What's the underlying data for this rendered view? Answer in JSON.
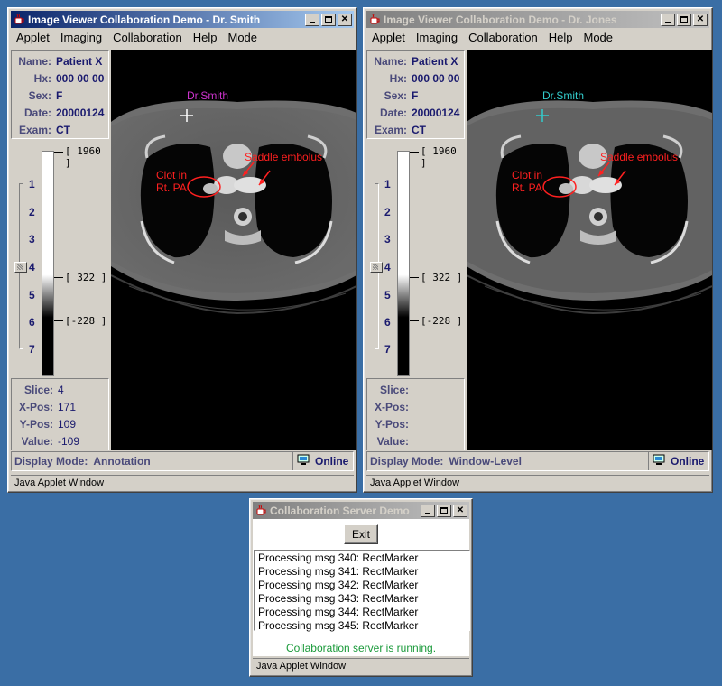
{
  "left_window": {
    "title": "Image Viewer Collaboration Demo - Dr. Smith",
    "menu": [
      "Applet",
      "Imaging",
      "Collaboration",
      "Help",
      "Mode"
    ],
    "patient": {
      "name_label": "Name:",
      "name": "Patient X",
      "hx_label": "Hx:",
      "hx": "000 00 00",
      "sex_label": "Sex:",
      "sex": "F",
      "date_label": "Date:",
      "date": "20000124",
      "exam_label": "Exam:",
      "exam": "CT"
    },
    "slices": [
      "1",
      "2",
      "3",
      "4",
      "5",
      "6",
      "7"
    ],
    "window_levels": [
      "[ 1960 ]",
      "[ 322 ]",
      "[-228 ]"
    ],
    "position": {
      "slice_label": "Slice:",
      "slice": "4",
      "xpos_label": "X-Pos:",
      "xpos": "171",
      "ypos_label": "Y-Pos:",
      "ypos": "109",
      "value_label": "Value:",
      "value": "-109"
    },
    "cursor_label": "Dr.Smith",
    "cursor_color": "#cc33cc",
    "annotations": {
      "saddle": "Saddle embolus",
      "clot1": "Clot in",
      "clot2": "Rt. PA"
    },
    "display_mode_label": "Display Mode:",
    "display_mode": "Annotation",
    "online": "Online",
    "applet_status": "Java Applet Window"
  },
  "right_window": {
    "title": "Image Viewer Collaboration Demo - Dr. Jones",
    "menu": [
      "Applet",
      "Imaging",
      "Collaboration",
      "Help",
      "Mode"
    ],
    "patient": {
      "name_label": "Name:",
      "name": "Patient X",
      "hx_label": "Hx:",
      "hx": "000 00 00",
      "sex_label": "Sex:",
      "sex": "F",
      "date_label": "Date:",
      "date": "20000124",
      "exam_label": "Exam:",
      "exam": "CT"
    },
    "slices": [
      "1",
      "2",
      "3",
      "4",
      "5",
      "6",
      "7"
    ],
    "window_levels": [
      "[ 1960 ]",
      "[ 322 ]",
      "[-228 ]"
    ],
    "position": {
      "slice_label": "Slice:",
      "slice": "",
      "xpos_label": "X-Pos:",
      "xpos": "",
      "ypos_label": "Y-Pos:",
      "ypos": "",
      "value_label": "Value:",
      "value": ""
    },
    "cursor_label": "Dr.Smith",
    "cursor_color": "#33cccc",
    "annotations": {
      "saddle": "Saddle embolus",
      "clot1": "Clot in",
      "clot2": "Rt. PA"
    },
    "display_mode_label": "Display Mode:",
    "display_mode": "Window-Level",
    "online": "Online",
    "applet_status": "Java Applet Window"
  },
  "server_window": {
    "title": "Collaboration Server Demo",
    "exit_label": "Exit",
    "log": [
      "Processing msg 340:  RectMarker",
      "Processing msg 341:  RectMarker",
      "Processing msg 342:  RectMarker",
      "Processing msg 343:  RectMarker",
      "Processing msg 344:  RectMarker",
      "Processing msg 345:  RectMarker"
    ],
    "status": "Collaboration server is running.",
    "applet_status": "Java Applet Window"
  },
  "colors": {
    "desktop": "#3a6ea5",
    "active_title": "#0a246a",
    "annotation": "#ff2020",
    "server_status": "#1a9a3a"
  }
}
